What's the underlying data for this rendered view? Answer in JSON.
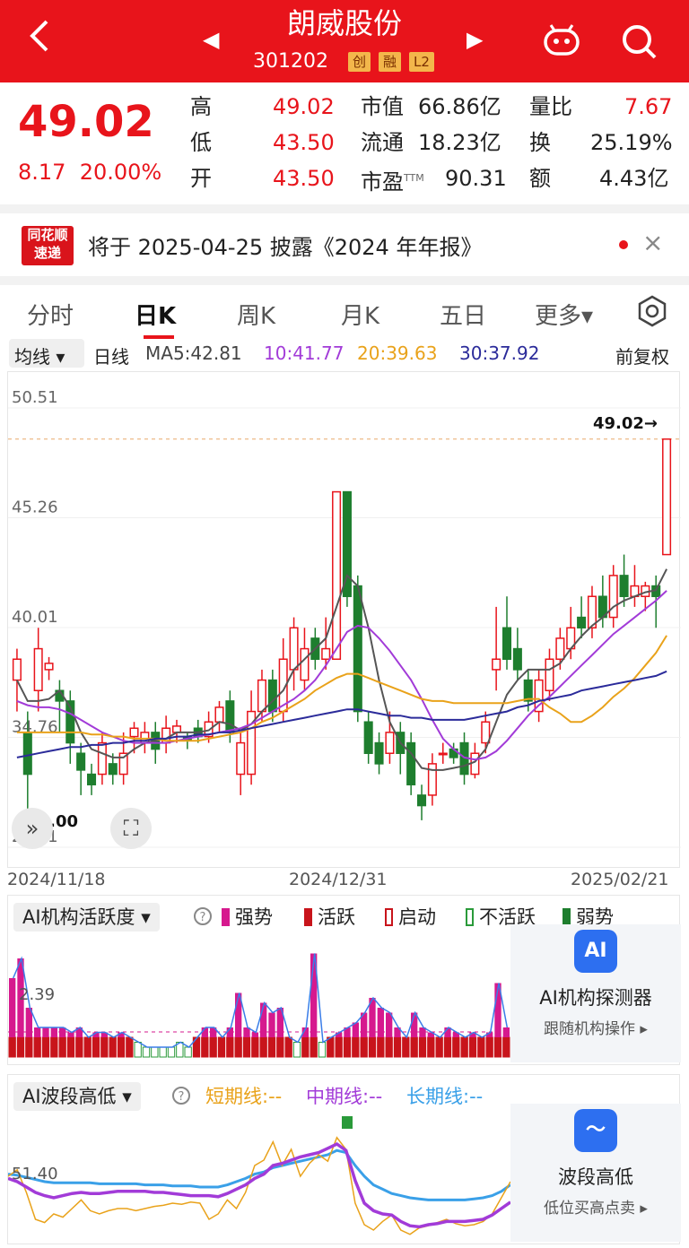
{
  "header": {
    "back_icon": "back-arrow-icon",
    "title": "朗威股份",
    "code": "301202",
    "badges": [
      "创",
      "融",
      "L2"
    ],
    "prev_icon": "prev-stock-icon",
    "next_icon": "next-stock-icon",
    "robot_icon": "robot-icon",
    "search_icon": "search-icon"
  },
  "quote": {
    "price": "49.02",
    "change": "8.17",
    "change_pct": "20.00%",
    "fields": [
      {
        "label": "高",
        "value": "49.02"
      },
      {
        "label": "市值",
        "value": "66.86亿"
      },
      {
        "label": "量比",
        "value": "7.67"
      },
      {
        "label": "低",
        "value": "43.50"
      },
      {
        "label": "流通",
        "value": "18.23亿"
      },
      {
        "label": "换",
        "value": "25.19%"
      },
      {
        "label": "开",
        "value": "43.50"
      },
      {
        "label": "市盈",
        "sup": "TTM",
        "value": "90.31"
      },
      {
        "label": "额",
        "value": "4.43亿"
      }
    ]
  },
  "news": {
    "logo_top": "同花顺",
    "logo_bottom": "速递",
    "text": "将于 2025-04-25 披露《2024 年年报》",
    "close": "×"
  },
  "tabs": [
    "分时",
    "日K",
    "周K",
    "月K",
    "五日",
    "更多▾"
  ],
  "ma": {
    "selector": "均线 ▾",
    "period": "日线",
    "ma5": "MA5:42.81",
    "ma10": "10:41.77",
    "ma20": "20:39.63",
    "ma30": "30:37.92",
    "adjust": "前复权"
  },
  "chart_data": {
    "type": "candlestick",
    "y_ticks": [
      "50.51",
      "45.26",
      "40.01",
      "34.76",
      "29.51"
    ],
    "ylim": [
      29.51,
      50.51
    ],
    "x_labels": [
      "2024/11/18",
      "2024/12/31",
      "2025/02/21"
    ],
    "high_mark": "49.02→",
    "low_mark": "←31.00",
    "candles": [
      [
        37.5,
        38.5,
        36,
        39
      ],
      [
        35,
        33,
        31,
        36
      ],
      [
        37,
        39,
        36,
        40
      ],
      [
        38,
        38.3,
        37.5,
        38.6
      ],
      [
        37,
        36.5,
        35,
        37.5
      ],
      [
        36.5,
        34.5,
        33.5,
        37
      ],
      [
        34,
        33.2,
        32,
        34.5
      ],
      [
        33,
        32.5,
        32,
        33.5
      ],
      [
        33,
        34.5,
        32.5,
        35
      ],
      [
        33.5,
        33,
        32.5,
        34
      ],
      [
        33,
        34,
        32.5,
        35
      ],
      [
        34.8,
        35.2,
        34,
        35.5
      ],
      [
        34.5,
        35,
        34,
        35.5
      ],
      [
        35,
        34.2,
        33.5,
        35.5
      ],
      [
        34.5,
        35.2,
        34,
        35.8
      ],
      [
        35,
        35.3,
        34.5,
        35.6
      ],
      [
        34.8,
        34.6,
        34.2,
        35
      ],
      [
        35.2,
        34.8,
        34.5,
        35.6
      ],
      [
        34.8,
        35.5,
        34.5,
        36
      ],
      [
        35.5,
        36.2,
        35,
        36.5
      ],
      [
        36.5,
        35,
        34.5,
        37
      ],
      [
        33,
        34.5,
        32,
        35
      ],
      [
        33,
        36,
        32.5,
        37
      ],
      [
        36,
        37.5,
        35.5,
        38
      ],
      [
        37.5,
        36,
        35.5,
        38
      ],
      [
        36,
        38.5,
        35.5,
        39.5
      ],
      [
        38,
        40,
        37,
        40.5
      ],
      [
        37.5,
        39,
        37,
        40
      ],
      [
        39.5,
        38.5,
        38,
        40
      ],
      [
        38.5,
        39,
        38,
        40.5
      ],
      [
        38.5,
        46.5,
        38.5,
        46.5
      ],
      [
        46.5,
        41.5,
        41,
        46.5
      ],
      [
        42,
        36,
        35.5,
        42.5
      ],
      [
        35.5,
        34,
        33.5,
        36
      ],
      [
        34.5,
        33.5,
        33,
        35
      ],
      [
        34,
        35,
        33.5,
        36
      ],
      [
        35,
        34,
        33,
        35.5
      ],
      [
        34.5,
        32.5,
        32,
        35
      ],
      [
        32,
        31.5,
        30.8,
        32.5
      ],
      [
        32,
        33.5,
        31.5,
        34
      ],
      [
        34,
        34,
        33.5,
        34.5
      ],
      [
        34.2,
        33.8,
        33.5,
        34.5
      ],
      [
        34.5,
        33,
        32.5,
        35
      ],
      [
        33,
        34,
        32.8,
        34.5
      ],
      [
        34.5,
        35.5,
        34,
        36
      ],
      [
        38,
        38.5,
        37,
        41
      ],
      [
        40,
        38.5,
        38,
        41.5
      ],
      [
        39,
        38,
        37.5,
        40
      ],
      [
        37.5,
        36.5,
        36,
        38
      ],
      [
        36,
        37.5,
        35.5,
        38
      ],
      [
        37,
        38.5,
        36.5,
        39
      ],
      [
        38.5,
        39.5,
        38,
        40
      ],
      [
        39,
        40,
        38.5,
        41
      ],
      [
        40.5,
        40,
        39.5,
        41.5
      ],
      [
        40,
        41.5,
        39.5,
        42
      ],
      [
        41.5,
        40.5,
        40,
        42.5
      ],
      [
        40.5,
        42.5,
        40,
        43
      ],
      [
        42.5,
        41.5,
        41,
        43.5
      ],
      [
        41.5,
        42,
        41,
        43
      ],
      [
        41.5,
        42,
        40.8,
        42.2
      ],
      [
        42,
        41.5,
        40,
        42.5
      ],
      [
        43.5,
        49.02,
        43.5,
        49.02
      ]
    ],
    "ma5": [
      37.5,
      36.5,
      36.5,
      36.6,
      37,
      36.2,
      35,
      34.2,
      34,
      33.8,
      33.8,
      34.2,
      34.5,
      34.6,
      34.7,
      35,
      35,
      35,
      35.1,
      35.5,
      35.4,
      35.1,
      35.4,
      36,
      36.5,
      37,
      38,
      38.5,
      39,
      39.5,
      41,
      42.5,
      42,
      40,
      37.5,
      35.5,
      34.5,
      34,
      33.3,
      33.2,
      33.2,
      33.3,
      33.4,
      33.6,
      34.2,
      35.5,
      36.8,
      37.5,
      38,
      38,
      38,
      38.3,
      39,
      39.6,
      40.1,
      40.5,
      41,
      41.3,
      41.5,
      41.7,
      41.8,
      42.81
    ],
    "ma10": [
      36.5,
      36.3,
      36.2,
      36.2,
      36.1,
      35.9,
      35.6,
      35.3,
      35,
      34.8,
      34.6,
      34.5,
      34.5,
      34.5,
      34.5,
      34.6,
      34.7,
      34.8,
      34.9,
      35,
      35.1,
      35.2,
      35.4,
      35.7,
      36,
      36.3,
      36.6,
      37,
      37.5,
      38.2,
      39,
      39.8,
      40.1,
      40,
      39.5,
      38.9,
      38.2,
      37.5,
      36.6,
      35.6,
      34.7,
      34.2,
      33.8,
      33.7,
      33.8,
      34.1,
      34.6,
      35.2,
      35.8,
      36.3,
      36.7,
      37.2,
      37.7,
      38.2,
      38.7,
      39.2,
      39.7,
      40.1,
      40.5,
      40.9,
      41.3,
      41.77
    ],
    "ma20": [
      35,
      35,
      35,
      35,
      35,
      35,
      35,
      34.9,
      34.9,
      34.8,
      34.8,
      34.7,
      34.7,
      34.7,
      34.6,
      34.6,
      34.6,
      34.6,
      34.7,
      34.8,
      34.9,
      35,
      35.2,
      35.5,
      35.7,
      36,
      36.3,
      36.6,
      37,
      37.3,
      37.6,
      37.8,
      37.8,
      37.6,
      37.4,
      37.2,
      37,
      36.8,
      36.6,
      36.5,
      36.5,
      36.4,
      36.4,
      36.4,
      36.4,
      36.4,
      36.4,
      36.5,
      36.6,
      36.6,
      36.2,
      35.9,
      35.5,
      35.5,
      35.8,
      36.2,
      36.7,
      37.1,
      37.6,
      38.2,
      38.8,
      39.63
    ],
    "ma30": [
      33.8,
      33.9,
      34,
      34.1,
      34.2,
      34.3,
      34.3,
      34.4,
      34.4,
      34.5,
      34.5,
      34.6,
      34.6,
      34.7,
      34.7,
      34.8,
      34.8,
      34.9,
      34.9,
      35,
      35,
      35.1,
      35.2,
      35.3,
      35.4,
      35.5,
      35.6,
      35.7,
      35.8,
      35.9,
      36,
      36.1,
      36.1,
      36,
      35.9,
      35.8,
      35.8,
      35.7,
      35.7,
      35.6,
      35.6,
      35.6,
      35.6,
      35.7,
      35.8,
      35.9,
      36,
      36.2,
      36.3,
      36.5,
      36.6,
      36.7,
      36.8,
      37,
      37.1,
      37.2,
      37.3,
      37.4,
      37.5,
      37.6,
      37.7,
      37.92
    ]
  },
  "ai_activity": {
    "selector": "AI机构活跃度 ▾",
    "help_icon": "help-circle-icon",
    "tick": "2.39",
    "legend": [
      {
        "label": "强势",
        "color": "#d6198e"
      },
      {
        "label": "活跃",
        "color": "#c8141b"
      },
      {
        "label": "启动",
        "color": "#c8141b"
      },
      {
        "label": "不活跃",
        "color": "#2a9a3a"
      },
      {
        "label": "弱势",
        "color": "#1e7e2e"
      }
    ],
    "bars": [
      0.8,
      1.0,
      0.5,
      0.3,
      0.3,
      0.3,
      0.3,
      0.25,
      0.3,
      0.2,
      0.25,
      0.25,
      0.2,
      0.25,
      0.2,
      0.15,
      0.1,
      0.1,
      0.1,
      0.1,
      0.15,
      0.1,
      0.2,
      0.3,
      0.3,
      0.2,
      0.3,
      0.65,
      0.3,
      0.25,
      0.55,
      0.45,
      0.5,
      0.2,
      0.15,
      0.3,
      1.05,
      0.15,
      0.2,
      0.25,
      0.3,
      0.35,
      0.45,
      0.6,
      0.5,
      0.45,
      0.3,
      0.2,
      0.45,
      0.3,
      0.25,
      0.2,
      0.3,
      0.25,
      0.2,
      0.25,
      0.2,
      0.25,
      0.75,
      0.3
    ],
    "side_title": "AI机构探测器",
    "side_sub": "跟随机构操作 ▸",
    "side_icon_text": "AI"
  },
  "ai_wave": {
    "selector": "AI波段高低 ▾",
    "short": "短期线:--",
    "mid": "中期线:--",
    "long": "长期线:--",
    "tick": "51.40",
    "short_line": [
      60,
      66,
      45,
      20,
      17,
      25,
      22,
      30,
      38,
      28,
      25,
      28,
      30,
      30,
      28,
      30,
      32,
      33,
      35,
      34,
      36,
      35,
      20,
      25,
      38,
      30,
      45,
      70,
      75,
      92,
      70,
      85,
      60,
      72,
      80,
      74,
      96,
      85,
      35,
      15,
      10,
      18,
      24,
      10,
      6,
      12,
      14,
      17,
      20,
      16,
      14,
      15,
      18,
      25,
      40,
      55
    ],
    "mid_line": [
      58,
      55,
      50,
      45,
      42,
      40,
      42,
      44,
      45,
      44,
      44,
      45,
      46,
      46,
      46,
      46,
      45,
      45,
      44,
      43,
      42,
      42,
      42,
      41,
      44,
      48,
      52,
      58,
      62,
      70,
      72,
      75,
      78,
      80,
      82,
      86,
      90,
      84,
      56,
      35,
      28,
      25,
      24,
      18,
      14,
      13,
      15,
      16,
      18,
      18,
      18,
      19,
      20,
      24,
      30,
      36
    ],
    "long_line": [
      62,
      61,
      59,
      57,
      55,
      54,
      54,
      54,
      54,
      54,
      53,
      53,
      53,
      53,
      53,
      52,
      52,
      52,
      51,
      51,
      51,
      50,
      50,
      50,
      52,
      55,
      58,
      62,
      64,
      68,
      70,
      72,
      74,
      76,
      78,
      80,
      84,
      82,
      70,
      60,
      52,
      48,
      44,
      42,
      40,
      39,
      38,
      38,
      38,
      38,
      38,
      39,
      40,
      42,
      46,
      52
    ],
    "side_title": "波段高低",
    "side_sub": "低位买高点卖 ▸",
    "side_icon_text": "〜"
  }
}
